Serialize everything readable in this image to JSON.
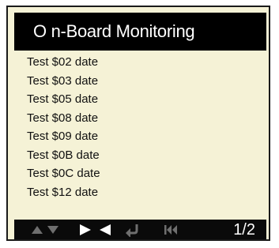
{
  "header": {
    "title": "O n-Board Monitoring"
  },
  "list": {
    "items": [
      "Test $02 date",
      "Test $03 date",
      "Test $05 date",
      "Test $08 date",
      "Test $09 date",
      "Test $0B date",
      "Test $0C date",
      "Test $12 date"
    ]
  },
  "footer": {
    "icons": {
      "up": "arrow-up-icon",
      "down": "arrow-down-icon",
      "right": "arrow-right-icon",
      "left": "arrow-left-icon",
      "enter": "enter-return-icon",
      "back": "skip-back-icon"
    },
    "page_indicator": "1/2"
  },
  "colors": {
    "screen_background": "#f5f2d6",
    "bar_background": "#000000",
    "active_icon": "#ffffff",
    "dim_icon": "#6e6e6e"
  }
}
